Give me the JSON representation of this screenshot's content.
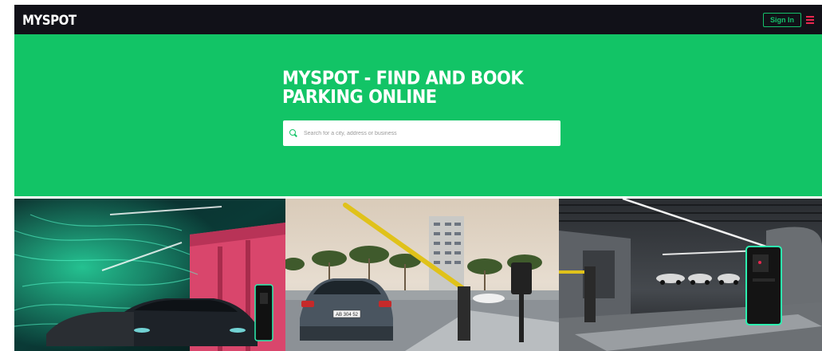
{
  "header": {
    "logo": "MYSPOT",
    "signin_label": "Sign In",
    "menu_icon": "hamburger-menu-icon"
  },
  "hero": {
    "title": "MYSPOT - FIND AND BOOK PARKING ONLINE",
    "search_placeholder": "Search for a city, address or business",
    "search_icon": "search-icon"
  },
  "tiles": [
    {
      "name": "ev-charging-garage-image"
    },
    {
      "name": "parking-barrier-car-image"
    },
    {
      "name": "underground-parking-terminal-image",
      "plate": ""
    }
  ],
  "plate_text": "AB 304 52",
  "colors": {
    "brand_green": "#12c466",
    "header_bg": "#111118",
    "accent_red": "#e8264f"
  }
}
